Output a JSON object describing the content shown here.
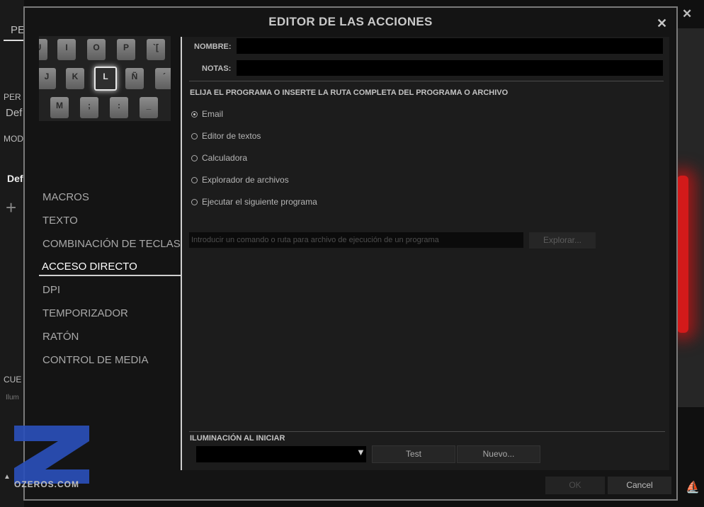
{
  "background": {
    "tab_partial": "PE",
    "per_label": "PER",
    "def1": "Def",
    "mod_label": "MOD",
    "def2": "Def",
    "cue_label": "CUE",
    "ilum_label": "Ilum"
  },
  "dialog": {
    "title": "EDITOR DE LAS ACCIONES",
    "close_icon": "close-icon"
  },
  "keyboard_preview": {
    "keys_row1": [
      "I",
      "O",
      "P",
      "`["
    ],
    "keys_row2": [
      "J",
      "K",
      "L",
      "Ñ"
    ],
    "keys_row3": [
      "M",
      ";",
      ":",
      "_"
    ],
    "selected_key": "L"
  },
  "menu": {
    "items": [
      {
        "label": "MACROS"
      },
      {
        "label": "TEXTO"
      },
      {
        "label": "COMBINACIÓN DE TECLAS"
      },
      {
        "label": "ACCESO DIRECTO"
      },
      {
        "label": "DPI"
      },
      {
        "label": "TEMPORIZADOR"
      },
      {
        "label": "RATÓN"
      },
      {
        "label": "CONTROL DE MEDIA"
      }
    ],
    "active": "ACCESO DIRECTO"
  },
  "form": {
    "name_label": "NOMBRE:",
    "name_value": "",
    "notes_label": "NOTAS:",
    "notes_value": "",
    "section_title": "ELIJA EL PROGRAMA O INSERTE LA RUTA COMPLETA DEL PROGRAMA O ARCHIVO",
    "options": [
      {
        "label": "Email",
        "selected": true
      },
      {
        "label": "Editor de textos",
        "selected": false
      },
      {
        "label": "Calculadora",
        "selected": false
      },
      {
        "label": "Explorador de archivos",
        "selected": false
      },
      {
        "label": "Ejecutar el siguiente programa",
        "selected": false
      }
    ],
    "command_placeholder": "Introducir un comando o ruta para archivo de ejecución de un programa",
    "explore_label": "Explorar...",
    "illumination_title": "ILUMINACIÓN AL INICIAR",
    "illumination_value": "",
    "test_label": "Test",
    "new_label": "Nuevo..."
  },
  "footer": {
    "ok_label": "OK",
    "cancel_label": "Cancel"
  },
  "logo": {
    "text": "OZEROS.COM",
    "color": "#2a4fb8"
  },
  "colors": {
    "accent_red": "#d31a1a",
    "logo_blue": "#2a4fb8"
  }
}
